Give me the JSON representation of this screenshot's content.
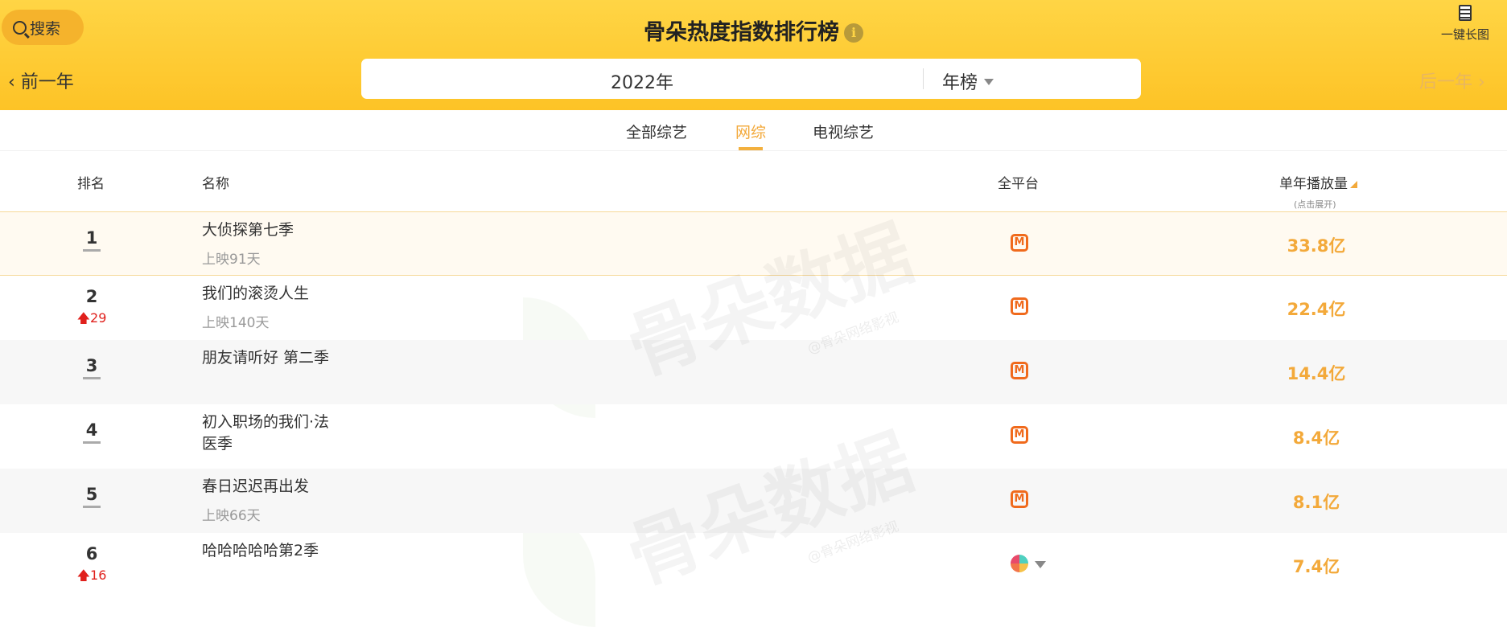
{
  "header": {
    "search_label": "搜索",
    "title": "骨朵热度指数排行榜",
    "long_image_label": "一键长图",
    "prev_label": "前一年",
    "next_label": "后一年",
    "year": "2022年",
    "list_type": "年榜"
  },
  "tabs": [
    {
      "label": "全部综艺"
    },
    {
      "label": "网综",
      "active": true
    },
    {
      "label": "电视综艺"
    }
  ],
  "columns": {
    "rank": "排名",
    "name": "名称",
    "platform": "全平台",
    "views": "单年播放量",
    "views_hint": "(点击展开)"
  },
  "watermark": {
    "text": "骨朵数据",
    "sub": "@骨朵网络影视"
  },
  "rows": [
    {
      "rank": "1",
      "name": "大侦探第七季",
      "days": "上映91天",
      "platform": "mango-tv",
      "views": "33.8亿"
    },
    {
      "rank": "2",
      "change": "29",
      "name": "我们的滚烫人生",
      "days": "上映140天",
      "platform": "mango-tv",
      "views": "22.4亿"
    },
    {
      "rank": "3",
      "name": "朋友请听好 第二季",
      "platform": "mango-tv",
      "views": "14.4亿"
    },
    {
      "rank": "4",
      "name": "初入职场的我们·法医季",
      "platform": "mango-tv",
      "views": "8.4亿"
    },
    {
      "rank": "5",
      "name": "春日迟迟再出发",
      "days": "上映66天",
      "platform": "mango-tv",
      "views": "8.1亿"
    },
    {
      "rank": "6",
      "change": "16",
      "name": "哈哈哈哈哈第2季",
      "platform": "multi-platform",
      "views": "7.4亿"
    }
  ],
  "colors": {
    "accent": "#f3a93a",
    "header": "#fdc326",
    "up": "#e0201c",
    "mango": "#f06a1c"
  }
}
